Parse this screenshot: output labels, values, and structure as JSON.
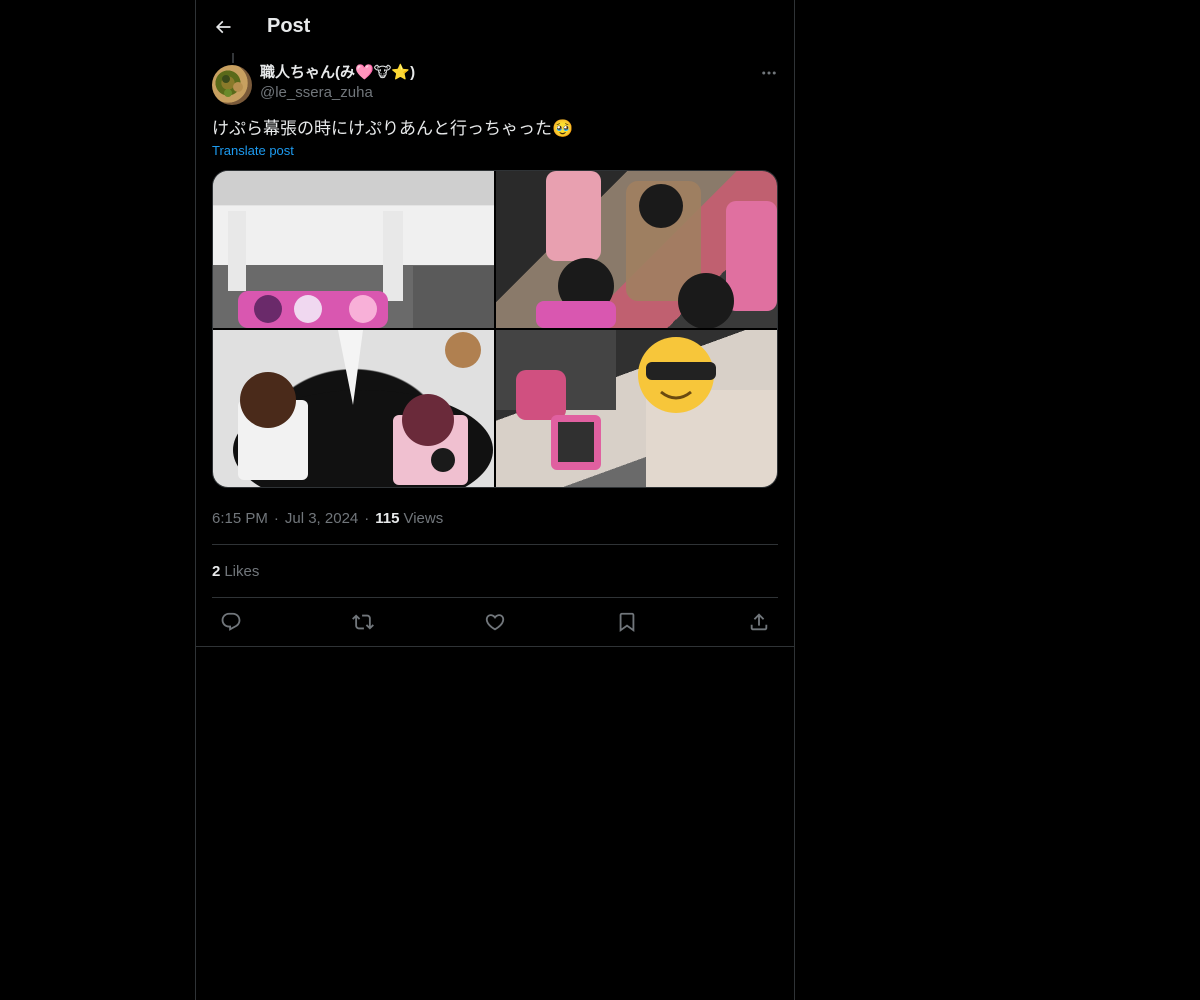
{
  "header": {
    "title": "Post"
  },
  "author": {
    "name": "職人ちゃん(み🩷🐮⭐)",
    "handle": "@le_ssera_zuha"
  },
  "post": {
    "text": "けぷら幕張の時にけぷりあんと行っちゃった🥹",
    "translate_label": "Translate post",
    "time": "6:15 PM",
    "date": "Jul 3, 2024",
    "views_count": "115",
    "views_label": "Views",
    "likes_count": "2",
    "likes_label": "Likes"
  },
  "icons": {
    "back": "back-arrow-icon",
    "more": "more-icon",
    "reply": "reply-icon",
    "repost": "repost-icon",
    "like": "heart-icon",
    "bookmark": "bookmark-icon",
    "share": "share-icon"
  },
  "colors": {
    "background": "#000000",
    "text": "#e7e9ea",
    "muted": "#71767b",
    "link": "#1d9bf0",
    "border": "#2f3336"
  }
}
